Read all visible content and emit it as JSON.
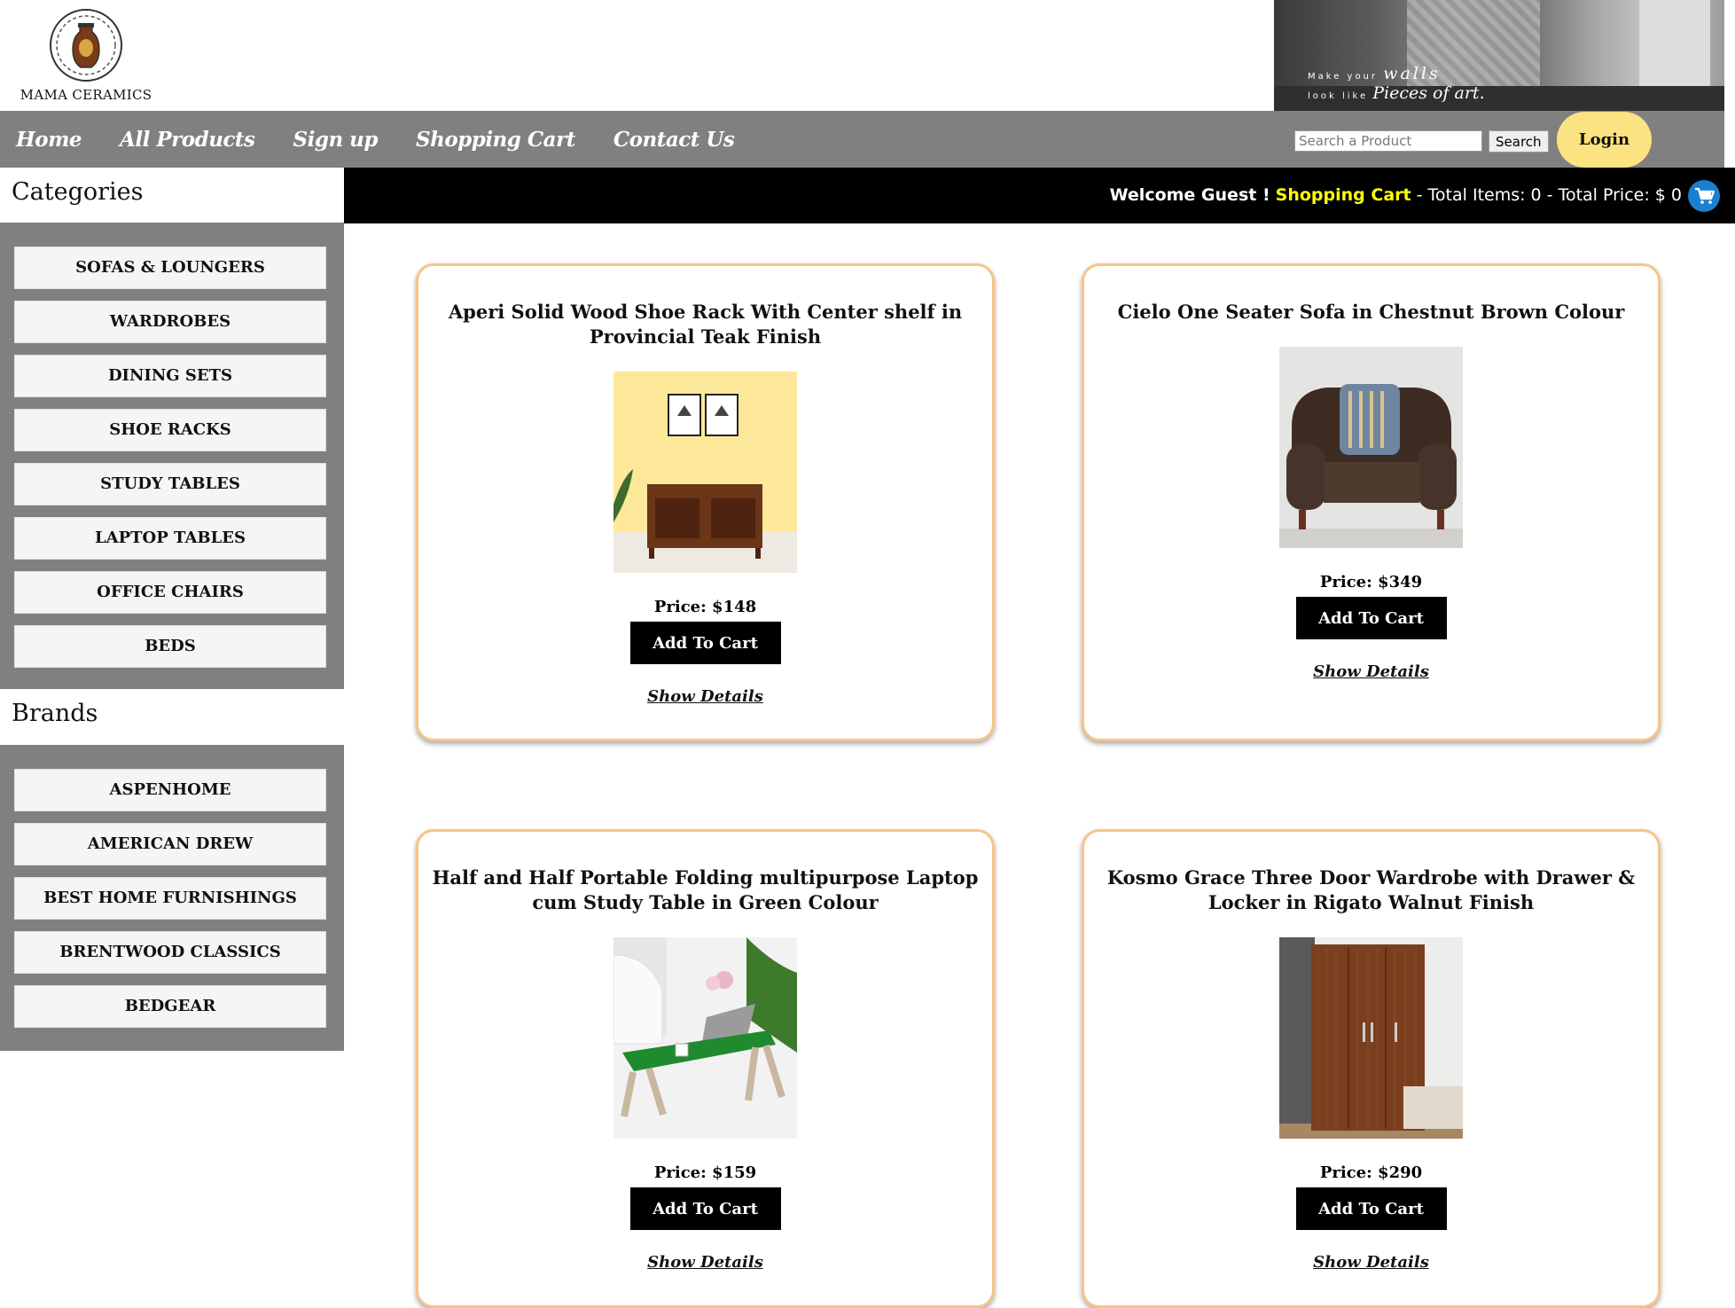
{
  "brand": {
    "name": "MAMA CERAMICS"
  },
  "banner": {
    "tag_small": "Make your",
    "tag_walls": "walls",
    "tag_small2": "look like",
    "tag_big": "Pieces of art."
  },
  "nav": {
    "items": [
      "Home",
      "All Products",
      "Sign up",
      "Shopping Cart",
      "Contact Us"
    ],
    "search_placeholder": "Search a Product",
    "search_button": "Search",
    "login": "Login"
  },
  "sidebar": {
    "categories_heading": "Categories",
    "categories": [
      "SOFAS & LOUNGERS",
      "WARDROBES",
      "DINING SETS",
      "SHOE RACKS",
      "STUDY TABLES",
      "LAPTOP TABLES",
      "OFFICE CHAIRS",
      "BEDS"
    ],
    "brands_heading": "Brands",
    "brands": [
      "ASPENHOME",
      "AMERICAN DREW",
      "BEST HOME FURNISHINGS",
      "BRENTWOOD CLASSICS",
      "BEDGEAR"
    ]
  },
  "welcome": {
    "greeting": "Welcome Guest !",
    "cart_link": "Shopping Cart",
    "totals": "- Total Items: 0 - Total Price: $ 0"
  },
  "products": [
    {
      "title": "Aperi Solid Wood Shoe Rack With Center shelf in Provincial Teak Finish",
      "price": "Price: $148",
      "add": "Add To Cart",
      "details": "Show Details"
    },
    {
      "title": "Cielo One Seater Sofa in Chestnut Brown Colour",
      "price": "Price: $349",
      "add": "Add To Cart",
      "details": "Show Details"
    },
    {
      "title": "Half and Half Portable Folding multipurpose Laptop cum Study Table in Green Colour",
      "price": "Price: $159",
      "add": "Add To Cart",
      "details": "Show Details"
    },
    {
      "title": "Kosmo Grace Three Door Wardrobe with Drawer & Locker in Rigato Walnut Finish",
      "price": "Price: $290",
      "add": "Add To Cart",
      "details": "Show Details"
    }
  ],
  "colors": {
    "nav_bg": "#808080",
    "login_bg": "#fbe381",
    "card_border": "#f7c48a",
    "cart_link": "#ffff00",
    "cart_icon": "#1a7fd0"
  }
}
